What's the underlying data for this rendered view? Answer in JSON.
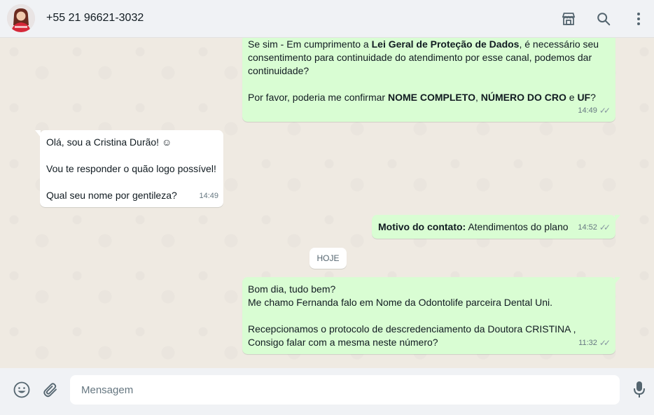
{
  "header": {
    "contact_name": "+55 21 96621-3032",
    "icons": [
      "avatar",
      "store-icon",
      "search-icon",
      "menu-dots-icon"
    ]
  },
  "messages": [
    {
      "direction": "outgoing",
      "html": "Se sim - Em cumprimento a <b>Lei Geral de Proteção de Dados</b>, é necessário seu consentimento para continuidade do atendimento por esse canal, podemos dar continuidade?<br><br>Por favor, poderia me confirmar <b>NOME COMPLETO</b>, <b>NÚMERO DO CRO</b> e <b>UF</b>?",
      "time": "14:49",
      "read": true
    },
    {
      "direction": "incoming",
      "html": "Olá, sou a Cristina Durão! ☺<br><br>Vou te responder o quão logo possível!<br><br>Qual seu nome por gentileza?",
      "time": "14:49"
    },
    {
      "direction": "outgoing",
      "html": "<b>Motivo do contato:</b> Atendimentos do plano",
      "time": "14:52",
      "read": true
    },
    {
      "direction": "outgoing",
      "html": "Bom dia, tudo bem?<br>Me chamo Fernanda falo em Nome da Odontolife parceira Dental Uni.<br><br>Recepcionamos o protocolo de descredenciamento da Doutora CRISTINA ,<br>Consigo falar com a mesma neste número?",
      "time": "11:32",
      "read": true
    }
  ],
  "day_divider": "HOJE",
  "composer": {
    "placeholder": "Mensagem",
    "value": "",
    "icons": [
      "emoji-icon",
      "attach-icon",
      "microphone-icon"
    ]
  },
  "colors": {
    "outgoing_bubble": "#d9fdd3",
    "incoming_bubble": "#ffffff",
    "chat_background": "#efeae2",
    "header_background": "#f0f2f5"
  }
}
